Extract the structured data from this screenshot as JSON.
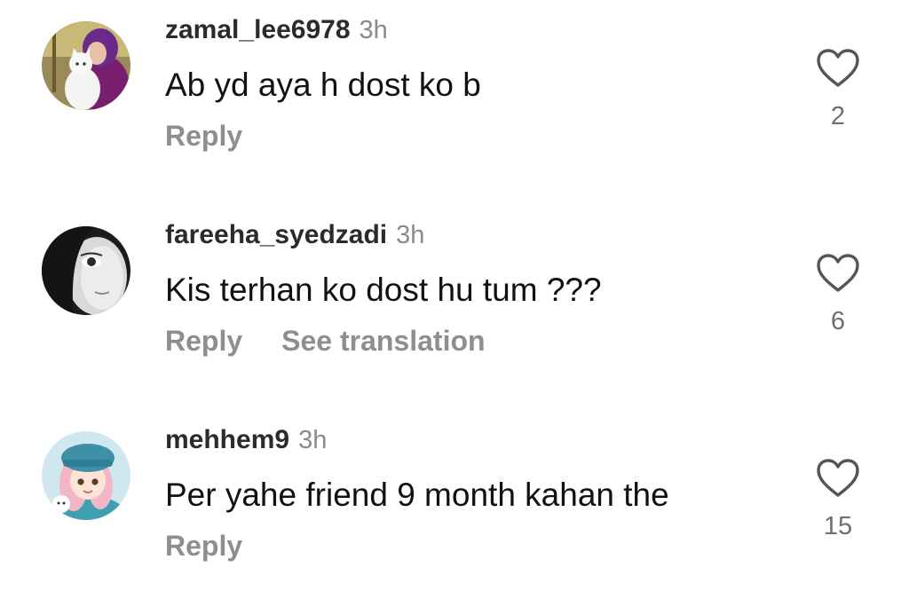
{
  "comments": [
    {
      "username": "zamal_lee6978",
      "time": "3h",
      "text": "Ab yd aya h dost ko b",
      "reply_label": "Reply",
      "likes": "2",
      "avatar": "girl-with-white-cat"
    },
    {
      "username": "fareeha_syedzadi",
      "time": "3h",
      "text": "Kis terhan ko dost hu tum ???",
      "reply_label": "Reply",
      "translation_label": "See translation",
      "likes": "6",
      "avatar": "monochrome-face"
    },
    {
      "username": "mehhem9",
      "time": "3h",
      "text": "Per yahe friend 9 month kahan the",
      "reply_label": "Reply",
      "likes": "15",
      "avatar": "cartoon-girl-blue-hat"
    }
  ],
  "icons": {
    "like": "heart-outline-icon"
  },
  "colors": {
    "username": "#2b2b2b",
    "text": "#111111",
    "muted": "#8e8e8e",
    "like_count": "#6f6f6f"
  }
}
